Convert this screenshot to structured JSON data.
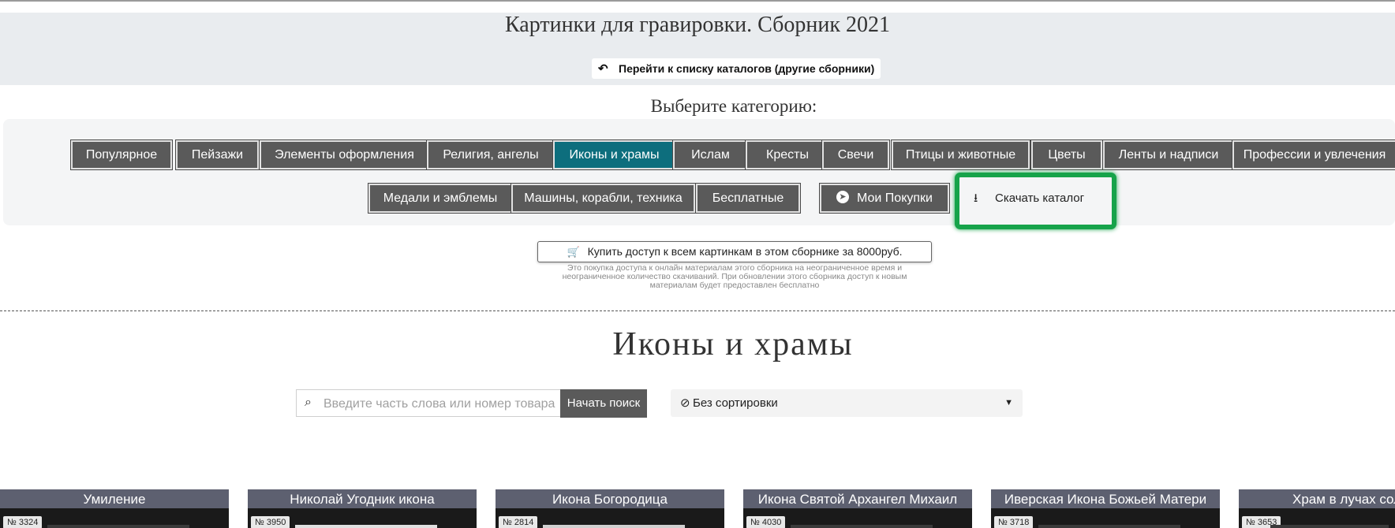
{
  "header": {
    "title": "Картинки для гравировки. Сборник 2021",
    "back_link": "Перейти к списку каталогов (другие сборники)"
  },
  "categories": {
    "label": "Выберите категорию:",
    "items": [
      "Популярное",
      "Пейзажи",
      "Элементы оформления",
      "Религия, ангелы",
      "Иконы и храмы",
      "Ислам",
      "Кресты",
      "Свечи",
      "Птицы и животные",
      "Цветы",
      "Ленты и надписи",
      "Профессии и увлечения",
      "Медали и эмблемы",
      "Машины, корабли, техника",
      "Бесплатные"
    ],
    "active": "Иконы и храмы",
    "my_purchases": "Мои Покупки",
    "download_catalog": "Скачать каталог"
  },
  "purchase": {
    "button": "Купить доступ к всем картинкам в этом сборнике за 8000руб.",
    "note": "Это покупка доступа к онлайн материалам этого сборника на неограниченное время и неограниченное количество скачиваний. При обновлении этого сборника доступ к новым материалам будет предоставлен бесплатно"
  },
  "section": {
    "title": "Иконы и храмы"
  },
  "search": {
    "placeholder": "Введите часть слова или номер товара",
    "button": "Начать поиск"
  },
  "sort": {
    "selected": "Без сортировки"
  },
  "products": [
    {
      "title": "Умиление",
      "number": "№ 3324"
    },
    {
      "title": "Николай Угодник икона",
      "number": "№ 3950"
    },
    {
      "title": "Икона Богородица",
      "number": "№ 2814"
    },
    {
      "title": "Икона Святой Архангел Михаил",
      "number": "№ 4030"
    },
    {
      "title": "Иверская Икона Божьей Матери",
      "number": "№ 3718"
    },
    {
      "title": "Храм в лучах солнца",
      "number": "№ 3653"
    }
  ],
  "colors": {
    "active_category": "#0d6e7d",
    "category_button": "#5a5a5a",
    "highlight": "#16a34a",
    "card_title_bg": "#5d6070"
  }
}
